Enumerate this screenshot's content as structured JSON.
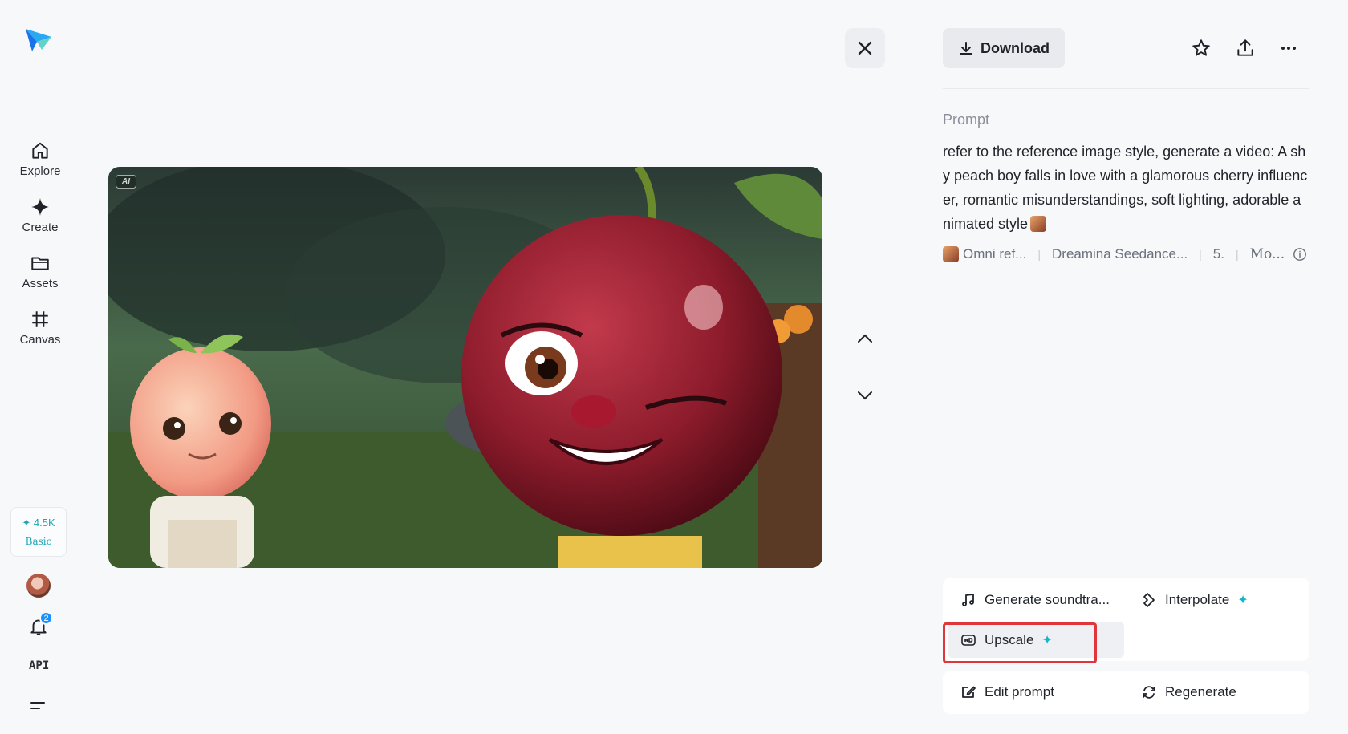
{
  "sidebar": {
    "items": [
      {
        "label": "Explore",
        "icon": "home-icon"
      },
      {
        "label": "Create",
        "icon": "diamond-icon"
      },
      {
        "label": "Assets",
        "icon": "folder-icon"
      },
      {
        "label": "Canvas",
        "icon": "frame-icon"
      }
    ],
    "credits": {
      "amount": "✦ 4.5K",
      "plan": "Basic"
    },
    "notifications_count": "2",
    "api_label": "API"
  },
  "viewer": {
    "ai_tag": "AI"
  },
  "panel": {
    "download_label": "Download",
    "prompt_label": "Prompt",
    "prompt_text": "refer to the reference image style, generate a video: A shy peach boy falls in love with a glamorous cherry influencer, romantic misunderstandings, soft lighting, adorable animated style",
    "meta": {
      "reference": "Omni ref...",
      "model": "Dreamina Seedance...",
      "version": "5.",
      "mode": "Mo..."
    },
    "actions": [
      {
        "label": "Generate soundtra...",
        "icon": "music-note-icon",
        "spark": ""
      },
      {
        "label": "Interpolate",
        "icon": "interpolate-icon",
        "spark": "✦"
      },
      {
        "label": "Upscale",
        "icon": "hd-icon",
        "spark": "✦"
      },
      {
        "label": "Edit prompt",
        "icon": "edit-icon",
        "spark": ""
      },
      {
        "label": "Regenerate",
        "icon": "refresh-icon",
        "spark": ""
      }
    ]
  },
  "colors": {
    "accent": "#12b5c9",
    "highlight": "#e0353b",
    "background": "#f7f8fa"
  }
}
